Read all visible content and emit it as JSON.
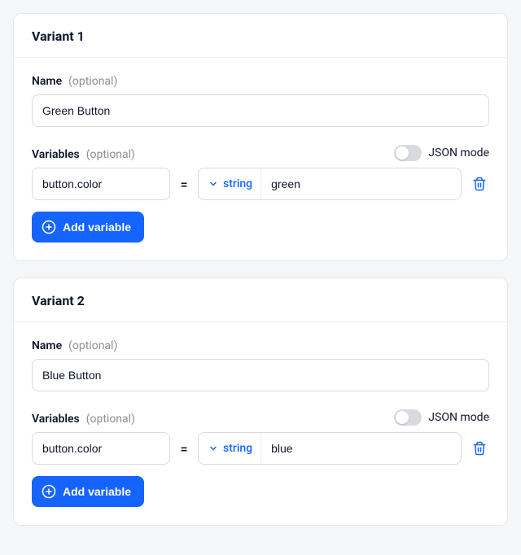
{
  "labels": {
    "name": "Name",
    "optional": "(optional)",
    "variables": "Variables",
    "json_mode": "JSON mode",
    "add_variable": "Add variable",
    "equals": "="
  },
  "variants": [
    {
      "title": "Variant 1",
      "name_value": "Green Button",
      "json_mode_on": false,
      "variable": {
        "key": "button.color",
        "type": "string",
        "value": "green"
      }
    },
    {
      "title": "Variant 2",
      "name_value": "Blue Button",
      "json_mode_on": false,
      "variable": {
        "key": "button.color",
        "type": "string",
        "value": "blue"
      }
    }
  ]
}
